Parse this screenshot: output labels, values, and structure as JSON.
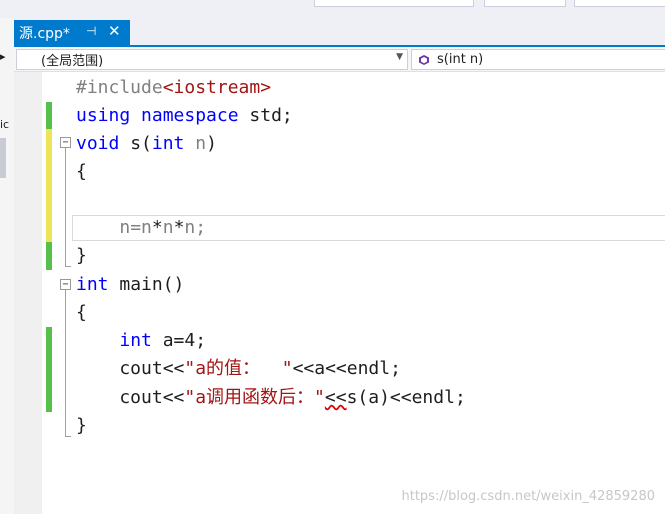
{
  "tab": {
    "title": "源.cpp*",
    "pin": "⊣",
    "close": "✕"
  },
  "nav": {
    "scope": "(全局范围)",
    "member": "s(int n)"
  },
  "sidebar_chars": [
    "▸",
    "ic"
  ],
  "code": {
    "l1a": "#include",
    "l1b": "<iostream>",
    "l2a": "using",
    "l2b": " ",
    "l2c": "namespace",
    "l2d": " std;",
    "l3a": "void",
    "l3b": " s(",
    "l3c": "int",
    "l3d": " ",
    "l3e": "n",
    "l3f": ")",
    "l4": "{",
    "l5": "",
    "l6a": "    ",
    "l6b": "n",
    "l6c": "=",
    "l6d": "n",
    "l6e": "*",
    "l6f": "n",
    "l6g": "*",
    "l6h": "n",
    "l6i": ";",
    "l7": "}",
    "l8a": "int",
    "l8b": " main()",
    "l9": "{",
    "l10a": "    ",
    "l10b": "int",
    "l10c": " a=4;",
    "l11a": "    cout<<",
    "l11b": "\"a的值：  \"",
    "l11c": "<<a<<endl;",
    "l12a": "    cout<<",
    "l12b": "\"a调用函数后：\"",
    "l12c": "<<",
    "l12d": "s(a)<<endl;",
    "l13": "}"
  },
  "watermark": "https://blog.csdn.net/weixin_42859280",
  "colors": {
    "tab_active": "#007acc",
    "keyword": "#0000ff",
    "string": "#a31515",
    "include": "#808080",
    "saved_change": "#57c04a",
    "unsaved_change": "#efe35a"
  }
}
